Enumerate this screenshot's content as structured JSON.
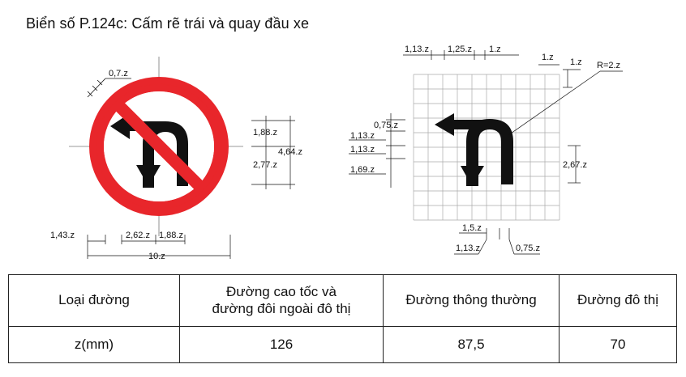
{
  "title": "Biển số P.124c: Cấm rẽ trái và quay đầu xe",
  "left_figure": {
    "dims": {
      "border": "0,7.z",
      "upper": "1,88.z",
      "lower": "2,77.z",
      "height": "4,64.z",
      "left": "1,43.z",
      "mid": "2,62.z",
      "right": "1,88.z",
      "width": "10.z"
    }
  },
  "right_figure": {
    "dims": {
      "top1": "1,13.z",
      "top2": "1,25.z",
      "top3": "1.z",
      "top4": "1.z",
      "top5": "1.z",
      "radius": "R=2.z",
      "l1": "0,75.z",
      "l2": "1,13.z",
      "l3": "1,13.z",
      "l4": "1,69.z",
      "right_h": "2,67.z",
      "b1": "1,5.z",
      "b2": "1,13.z",
      "b3": "0,75.z"
    }
  },
  "table": {
    "headers": [
      "Loại đường",
      "Đường cao tốc và\nđường đôi ngoài đô thị",
      "Đường thông thường",
      "Đường đô thị"
    ],
    "row_label": "z(mm)",
    "values": [
      "126",
      "87,5",
      "70"
    ]
  }
}
